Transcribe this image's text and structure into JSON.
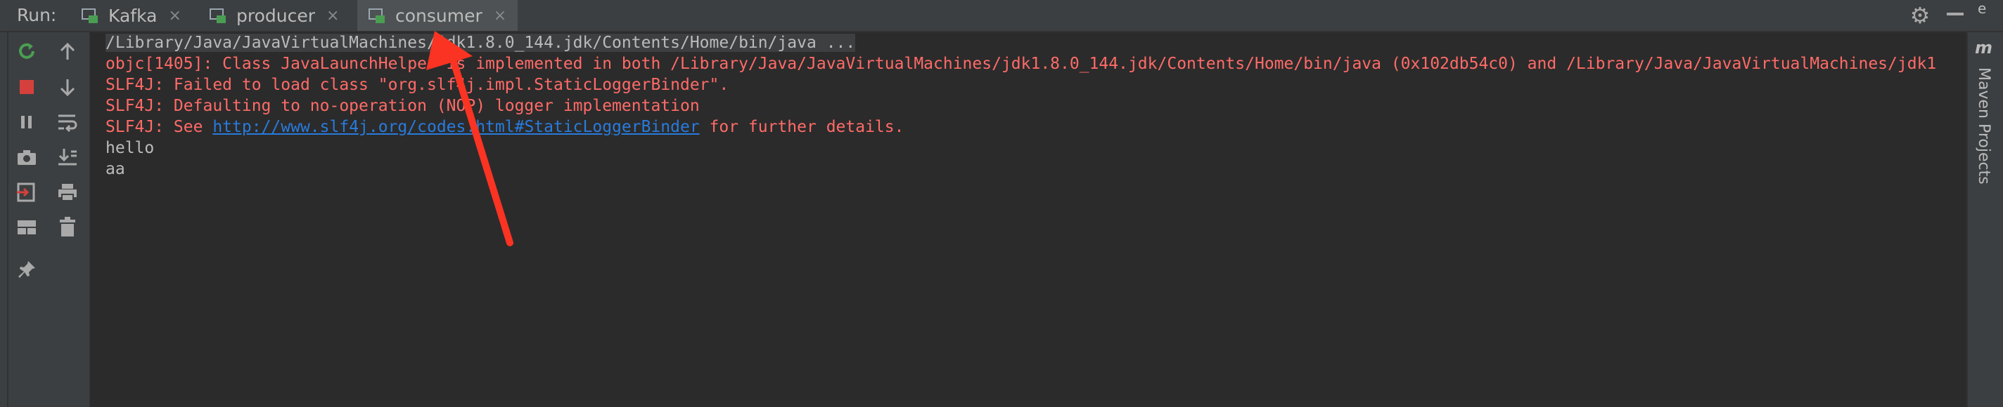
{
  "run": {
    "label": "Run:"
  },
  "tabs": [
    {
      "name": "Kafka",
      "close": "×",
      "active": false
    },
    {
      "name": "producer",
      "close": "×",
      "active": false
    },
    {
      "name": "consumer",
      "close": "×",
      "active": true
    }
  ],
  "console": {
    "command": "/Library/Java/JavaVirtualMachines/jdk1.8.0_144.jdk/Contents/Home/bin/java ...",
    "lines": [
      "objc[1405]: Class JavaLaunchHelper is implemented in both /Library/Java/JavaVirtualMachines/jdk1.8.0_144.jdk/Contents/Home/bin/java (0x102db54c0) and /Library/Java/JavaVirtualMachines/jdk1",
      "SLF4J: Failed to load class \"org.slf4j.impl.StaticLoggerBinder\".",
      "SLF4J: Defaulting to no-operation (NOP) logger implementation"
    ],
    "see_prefix": "SLF4J: See ",
    "see_link": "http://www.slf4j.org/codes.html#StaticLoggerBinder",
    "see_suffix": " for further details.",
    "output": [
      "hello",
      "aa"
    ]
  },
  "right_panel": {
    "label": "Maven Projects",
    "icon": "m"
  },
  "icons": {
    "rerun": "rerun-icon",
    "stop": "stop-icon",
    "pause": "pause-icon",
    "camera": "camera-icon",
    "login": "restore-layout-icon",
    "layout": "layout-icon",
    "pin": "pin-icon",
    "up": "arrow-up-icon",
    "down": "arrow-down-icon",
    "wrap": "soft-wrap-icon",
    "scroll": "scroll-to-end-icon",
    "print": "print-icon",
    "trash": "trash-icon",
    "gear": "gear-icon"
  },
  "colors": {
    "background": "#2b2b2b",
    "toolbar": "#3c3f41",
    "error": "#ff6b68",
    "text": "#bbbbbb",
    "link": "#287bde",
    "stop": "#d6403c",
    "rerun": "#4a9e52",
    "annotation": "#fa3323"
  }
}
